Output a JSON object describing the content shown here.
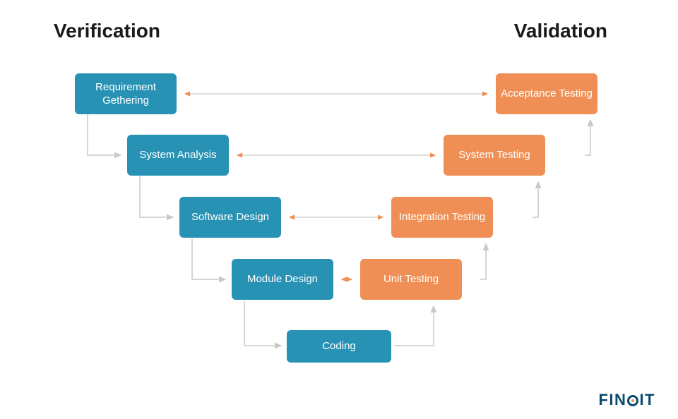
{
  "headings": {
    "verification": "Verification",
    "validation": "Validation"
  },
  "verification_boxes": [
    {
      "label": "Requirement\nGethering"
    },
    {
      "label": "System\nAnalysis"
    },
    {
      "label": "Software\nDesign"
    },
    {
      "label": "Module\nDesign"
    }
  ],
  "validation_boxes": [
    {
      "label": "Acceptance\nTesting"
    },
    {
      "label": "System\nTesting"
    },
    {
      "label": "Integration\nTesting"
    },
    {
      "label": "Unit\nTesting"
    }
  ],
  "coding": {
    "label": "Coding"
  },
  "colors": {
    "blue": "#2892b5",
    "orange": "#f08f55",
    "arrow_gray": "#c9c9c9",
    "arrow_orange": "#f08f55",
    "logo": "#0a4a6a"
  },
  "logo": {
    "text": "FINOIT"
  }
}
